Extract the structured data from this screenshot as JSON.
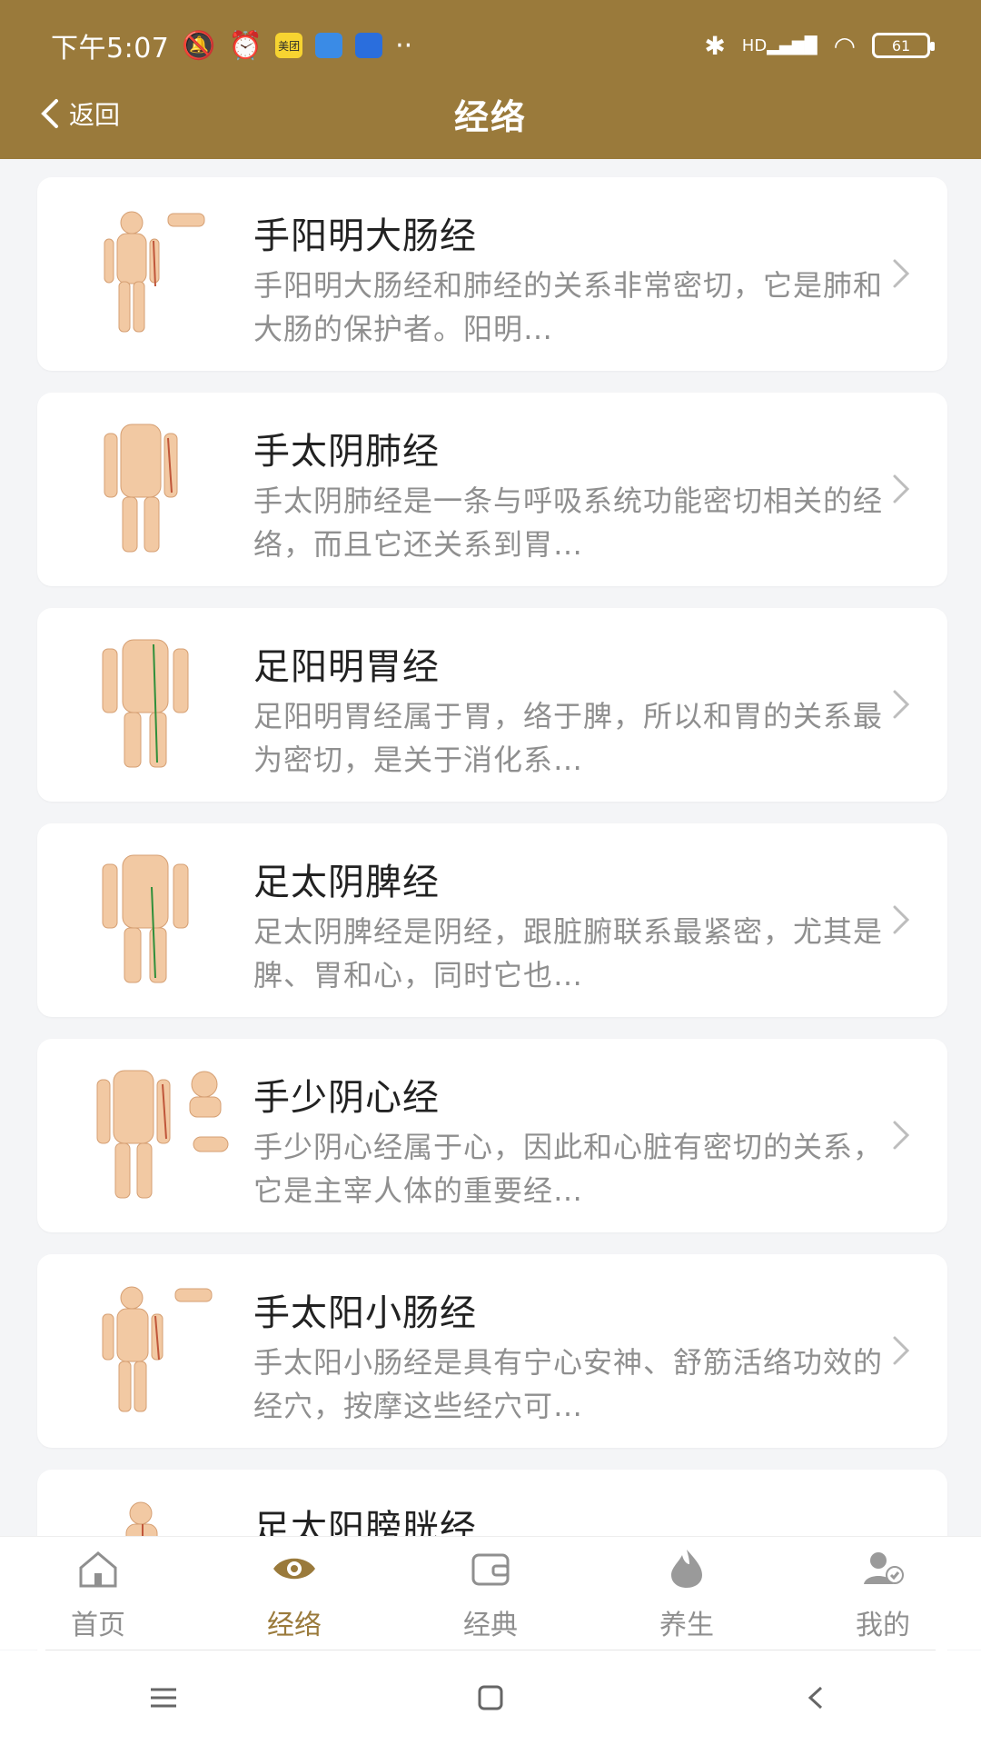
{
  "status": {
    "time": "下午5:07",
    "meituan_label": "美团",
    "battery": "61",
    "signal": "HD"
  },
  "nav": {
    "back_label": "返回",
    "title": "经络"
  },
  "items": [
    {
      "title": "手阳明大肠经",
      "desc": "手阳明大肠经和肺经的关系非常密切，它是肺和大肠的保护者。阳明…"
    },
    {
      "title": "手太阴肺经",
      "desc": "手太阴肺经是一条与呼吸系统功能密切相关的经络，而且它还关系到胃…"
    },
    {
      "title": "足阳明胃经",
      "desc": "足阳明胃经属于胃，络于脾，所以和胃的关系最为密切，是关于消化系…"
    },
    {
      "title": "足太阴脾经",
      "desc": "足太阴脾经是阴经，跟脏腑联系最紧密，尤其是脾、胃和心，同时它也…"
    },
    {
      "title": "手少阴心经",
      "desc": "手少阴心经属于心，因此和心脏有密切的关系，它是主宰人体的重要经…"
    },
    {
      "title": "手太阳小肠经",
      "desc": "手太阳小肠经是具有宁心安神、舒筋活络功效的经穴，按摩这些经穴可…"
    },
    {
      "title": "足太阳膀胱经",
      "desc": ""
    }
  ],
  "tabs": [
    {
      "label": "首页",
      "icon": "home-icon"
    },
    {
      "label": "经络",
      "icon": "eye-icon"
    },
    {
      "label": "经典",
      "icon": "wallet-icon"
    },
    {
      "label": "养生",
      "icon": "flame-icon"
    },
    {
      "label": "我的",
      "icon": "user-icon"
    }
  ],
  "colors": {
    "accent": "#9a7a3b",
    "muted": "#8f8f8f"
  }
}
